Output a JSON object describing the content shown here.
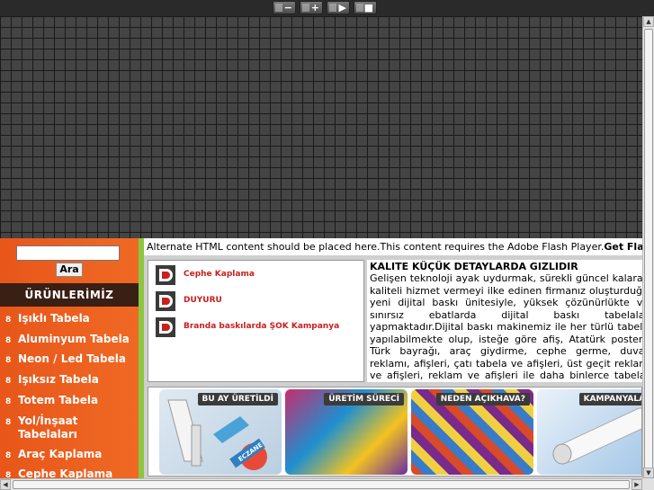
{
  "toolbar": {
    "zoom_out": "−",
    "zoom_in": "+",
    "play": "▶",
    "stop": "■"
  },
  "search": {
    "placeholder": "",
    "button_label": "Ara"
  },
  "categories": {
    "title": "ÜRÜNLERİMİZ",
    "bullet": "8",
    "items": [
      {
        "label": "Işıklı Tabela"
      },
      {
        "label": "Aluminyum Tabela"
      },
      {
        "label": "Neon / Led Tabela"
      },
      {
        "label": "Işıksız Tabela"
      },
      {
        "label": "Totem Tabela"
      },
      {
        "label": "Yol/İnşaat Tabelaları"
      },
      {
        "label": "Araç Kaplama"
      },
      {
        "label": "Cephe Kaplama"
      }
    ]
  },
  "flash": {
    "text": "Alternate HTML content should be placed here.This content requires the Adobe Flash Player.",
    "link": "Get Flash"
  },
  "news": {
    "items": [
      {
        "label": "Cephe Kaplama"
      },
      {
        "label": "DUYURU"
      },
      {
        "label": "Branda baskılarda ŞOK Kampanya"
      }
    ]
  },
  "quality": {
    "title": "KALITE KÜÇÜK DETAYLARDA GIZLIDIR",
    "body": "Gelişen teknoloji ayak uydurmak, sürekli güncel kalarak kaliteli hizmet vermeyi ilke edinen firmanız oluşturduğu yeni dijital baskı ünitesiyle, yüksek çözünürlükte ve sınırsız ebatlarda dijital baskı tabelalar yapmaktadır.Dijital baskı makinemiz ile her türlü tabela yapılabilmekte olup, isteğe göre afiş, Atatürk posteri, Türk bayrağı, araç giydirme, cephe germe, duvar reklamı, afişleri, çatı tabela ve afişleri, üst geçit reklam ve afişleri, reklam ve afişleri ile daha binlerce tabela, afiş ve dijital baskılarıyla hizmetinizdeyiz."
  },
  "banners": [
    {
      "caption": "BU AY ÜRETİLDİ",
      "sign_text": "ECZANE"
    },
    {
      "caption": "ÜRETİM SÜRECİ"
    },
    {
      "caption": "NEDEN AÇIKHAVA?"
    },
    {
      "caption": "KAMPANYALAR"
    }
  ],
  "colors": {
    "sidebar_orange": "#e8561a",
    "sidebar_green": "#8cc640",
    "news_red": "#c8201c",
    "title_bar": "#3a1f14"
  }
}
